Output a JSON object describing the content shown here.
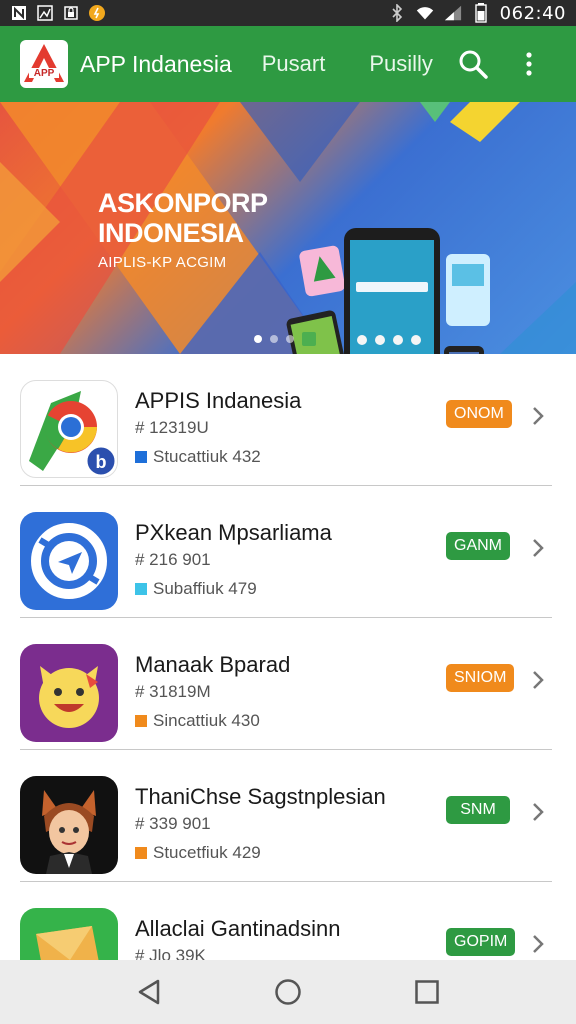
{
  "status_bar": {
    "time": "062:40",
    "icons": [
      "n-notification-icon",
      "image-notification-icon",
      "lock-notification-icon",
      "alert-notification-icon",
      "bluetooth-icon",
      "wifi-icon",
      "signal-icon",
      "battery-icon"
    ]
  },
  "app_bar": {
    "logo_text": "APP",
    "title": "APP Indanesia",
    "nav": [
      "Pusart",
      "Pusilly"
    ],
    "icons": [
      "search-icon",
      "more-vert-icon"
    ],
    "color": "#2e9a42"
  },
  "banner": {
    "line1": "ASKONPORP",
    "line2": "INDONESIA",
    "line3": "AIPLIS-KP ACGIM",
    "dots_active": 0
  },
  "apps": [
    {
      "name": "APPIS Indanesia",
      "id": "# 12319U",
      "category": "Stucattiuk 432",
      "badge": "ONOM",
      "badge_color": "#f08a1c",
      "square_color": "#1e6fd9",
      "icon": "chrome-b-icon"
    },
    {
      "name": "PXkean Mpsarliama",
      "id": "# 216 901",
      "category": "Subaffiuk 479",
      "badge": "GANM",
      "badge_color": "#2e9a42",
      "square_color": "#3dc3e8",
      "icon": "circle-send-icon"
    },
    {
      "name": "Manaak Bparad",
      "id": "# 31819M",
      "category": "Sincattiuk 430",
      "badge": "SNIOM",
      "badge_color": "#f08a1c",
      "square_color": "#f08a1c",
      "icon": "cat-face-icon"
    },
    {
      "name": "ThaniChse Sagstnplesian",
      "id": "# 339 901",
      "category": "Stucetfiuk 429",
      "badge": "SNM",
      "badge_color": "#2e9a42",
      "square_color": "#f08a1c",
      "icon": "fox-person-icon"
    },
    {
      "name": "Allaclai Gantinadsinn",
      "id": "# Jlo 39K",
      "category": "",
      "badge": "GOPIM",
      "badge_color": "#2e9a42",
      "square_color": "#2e9a42",
      "icon": "envelope-icon"
    }
  ],
  "nav_bar": {
    "icons": [
      "back-triangle-icon",
      "home-circle-icon",
      "recents-square-icon"
    ]
  }
}
